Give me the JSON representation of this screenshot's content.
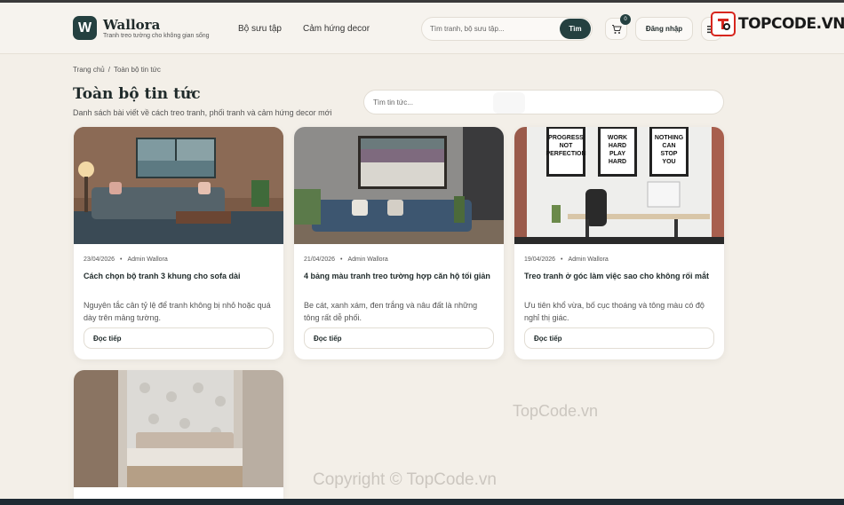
{
  "header": {
    "logo_letter": "W",
    "brand": "Wallora",
    "tagline": "Tranh treo tường cho không gian sống",
    "nav": [
      "Bộ sưu tập",
      "Cảm hứng decor"
    ],
    "search_placeholder": "Tìm tranh, bộ sưu tập...",
    "search_button": "Tìm",
    "cart_count": "0",
    "cart_icon": "cart-icon",
    "login": "Đăng nhập",
    "menu_icon": "menu-icon"
  },
  "watermark": {
    "logo_text": "TOPCODE.VN",
    "mid_text": "TopCode.vn",
    "bottom_text": "Copyright © TopCode.vn"
  },
  "breadcrumb": [
    "Trang chủ",
    "Toàn bộ tin tức"
  ],
  "page": {
    "title": "Toàn bộ tin tức",
    "subtitle": "Danh sách bài viết về cách treo tranh, phối tranh và cảm hứng decor mới",
    "news_search_placeholder": "Tìm tin tức..."
  },
  "articles": [
    {
      "date": "23/04/2026",
      "author": "Admin Wallora",
      "title": "Cách chọn bộ tranh 3 khung cho sofa dài",
      "excerpt": "Nguyên tắc cân tỷ lệ để tranh không bị nhỏ hoặc quá dày trên mảng tường.",
      "button": "Đọc tiếp"
    },
    {
      "date": "21/04/2026",
      "author": "Admin Wallora",
      "title": "4 bảng màu tranh treo tường hợp căn hộ tối giản",
      "excerpt": "Be cát, xanh xám, đen trắng và nâu đất là những tông rất dễ phối.",
      "button": "Đọc tiếp"
    },
    {
      "date": "19/04/2026",
      "author": "Admin Wallora",
      "title": "Treo tranh ở góc làm việc sao cho không rối mắt",
      "excerpt": "Ưu tiên khổ vừa, bố cục thoáng và tông màu có độ nghỉ thị giác.",
      "button": "Đọc tiếp",
      "poster_texts": [
        "PROGRESS NOT PERFECTION",
        "WORK HARD PLAY HARD",
        "NOTHING CAN STOP YOU"
      ]
    }
  ]
}
